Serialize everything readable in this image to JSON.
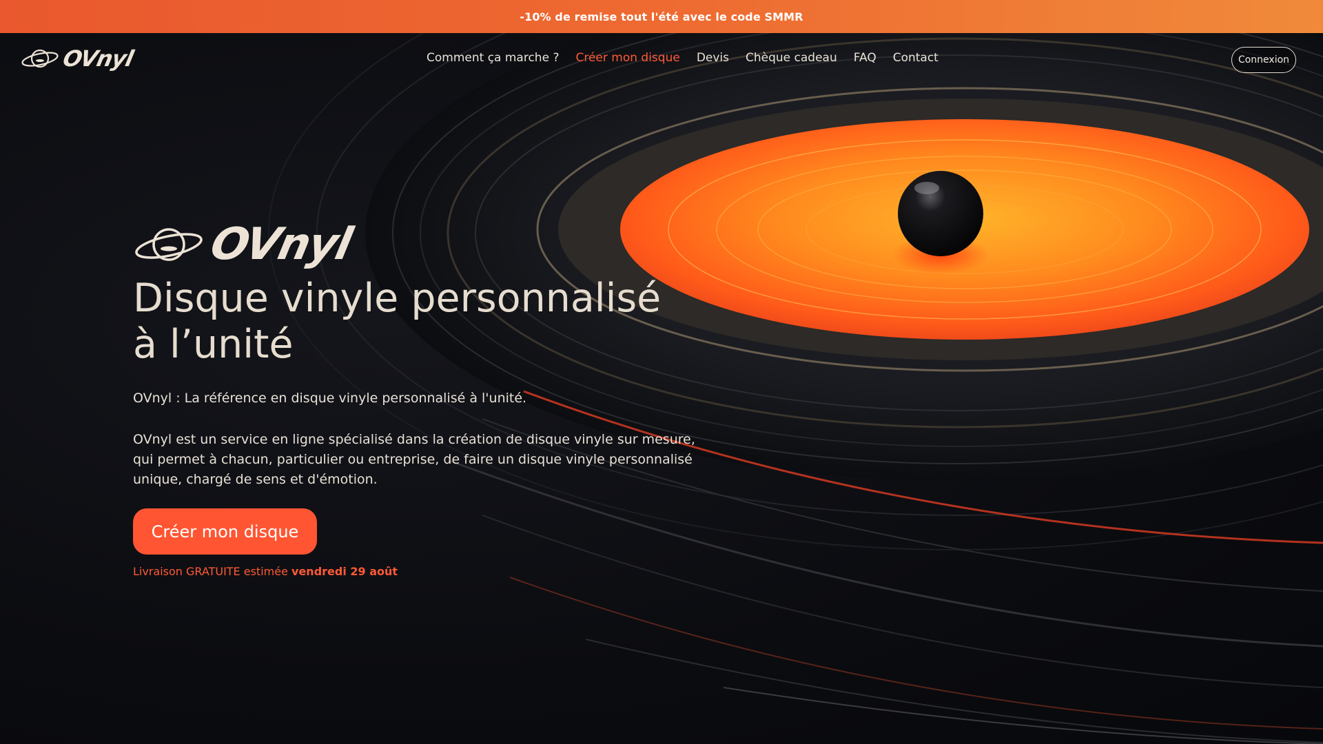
{
  "promo": {
    "text": "-10% de remise tout l'été avec le code SMMR"
  },
  "brand": {
    "name": "OVnyl",
    "icon": "saturn-planet-logo-icon"
  },
  "nav": {
    "items": [
      {
        "label": "Comment ça marche ?",
        "active": false
      },
      {
        "label": "Créer mon disque",
        "active": true
      },
      {
        "label": "Devis",
        "active": false
      },
      {
        "label": "Chèque cadeau",
        "active": false
      },
      {
        "label": "FAQ",
        "active": false
      },
      {
        "label": "Contact",
        "active": false
      }
    ],
    "login_label": "Connexion"
  },
  "hero": {
    "logo_name": "OVnyl",
    "title_line1": "Disque vinyle personnalisé",
    "title_line2": "à l’unité",
    "intro": "OVnyl : La référence en disque vinyle personnalisé à l'unité.",
    "desc_line1": "OVnyl est un service en ligne spécialisé dans la création de disque vinyle sur mesure,",
    "desc_line2": "qui permet à chacun, particulier ou entreprise, de faire un disque vinyle personnalisé",
    "desc_line3": "unique, chargé de sens et d'émotion.",
    "cta_label": "Créer mon disque",
    "delivery_prefix": "Livraison GRATUITE estimée ",
    "delivery_date": "vendredi 29 août"
  },
  "colors": {
    "accent": "#ff5533",
    "promo_start": "#e9582e",
    "promo_end": "#f08a3a",
    "text": "#e8e1d6",
    "background": "#0b0c10"
  }
}
